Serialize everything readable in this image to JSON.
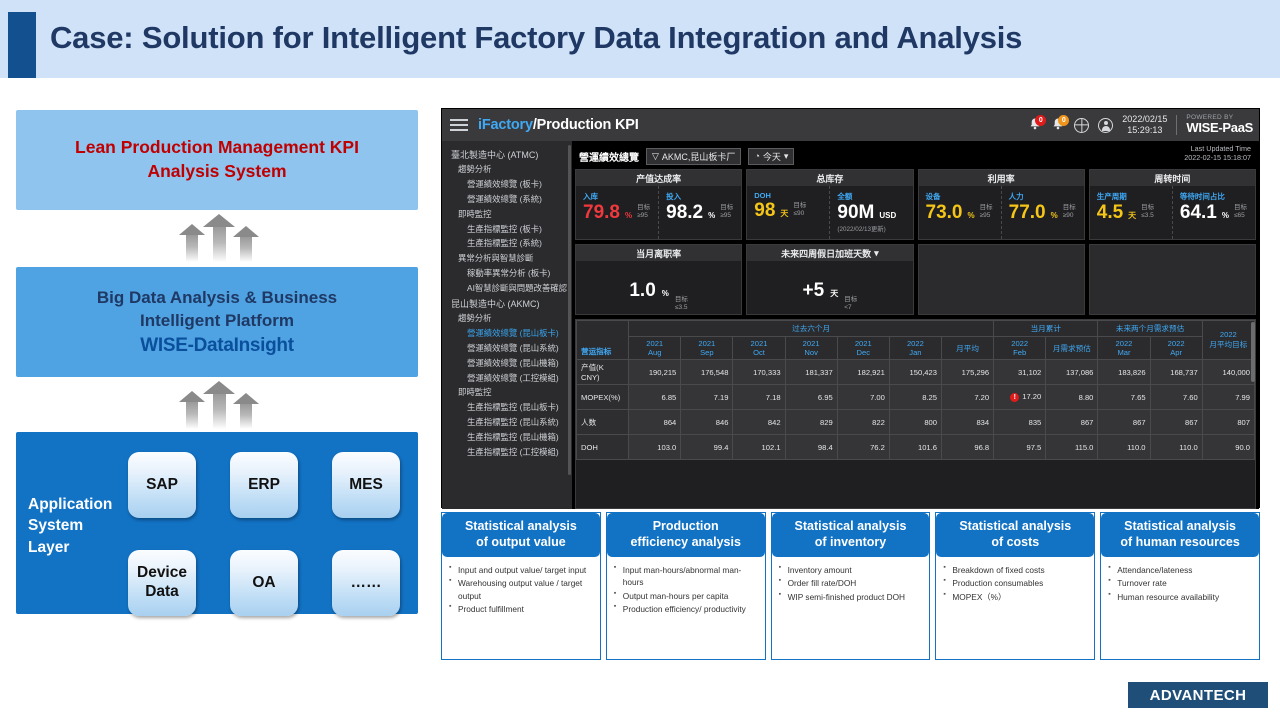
{
  "title": "Case: Solution for Intelligent Factory Data Integration and Analysis",
  "left_stack": {
    "layer1": "Lean Production Management KPI\nAnalysis System",
    "layer1_line1": "Lean Production Management KPI",
    "layer1_line2": "Analysis System",
    "layer2_line1": "Big Data Analysis & Business",
    "layer2_line2": "Intelligent  Platform",
    "layer2_product": "WISE-DataInsight",
    "app_layer_label": "Application\nSystem\nLayer",
    "app_tiles": [
      "SAP",
      "ERP",
      "MES",
      "Device\nData",
      "OA",
      "……"
    ]
  },
  "dashboard": {
    "brand_prefix": "iFactory",
    "brand_suffix": "/Production KPI",
    "notifications": [
      {
        "icon": "bell-icon",
        "count": "0",
        "color": "#e01b1b"
      },
      {
        "icon": "bell-alert-icon",
        "count": "0",
        "color": "#f0951b"
      }
    ],
    "date": "2022/02/15",
    "time": "15:29:13",
    "powered_by_small": "POWERED BY",
    "powered_by_brand": "WISE-PaaS",
    "sidebar": [
      {
        "label": "臺北製造中心 (ATMC)",
        "level": 0,
        "active": false
      },
      {
        "label": "趨勢分析",
        "level": 1,
        "active": false
      },
      {
        "label": "營運績效總覽 (板卡)",
        "level": 2,
        "active": false
      },
      {
        "label": "營運績效總覽 (系統)",
        "level": 2,
        "active": false
      },
      {
        "label": "即時監控",
        "level": 1,
        "active": false
      },
      {
        "label": "生產指標監控 (板卡)",
        "level": 2,
        "active": false
      },
      {
        "label": "生產指標監控 (系統)",
        "level": 2,
        "active": false
      },
      {
        "label": "異常分析與智慧診斷",
        "level": 1,
        "active": false
      },
      {
        "label": "稼動率異常分析 (板卡)",
        "level": 2,
        "active": false
      },
      {
        "label": "AI智慧診斷與問題改善確認",
        "level": 2,
        "active": false
      },
      {
        "label": "昆山製造中心 (AKMC)",
        "level": 0,
        "active": false
      },
      {
        "label": "趨勢分析",
        "level": 1,
        "active": false
      },
      {
        "label": "營運績效總覽 (昆山板卡)",
        "level": 2,
        "active": true
      },
      {
        "label": "營運績效總覽 (昆山系統)",
        "level": 2,
        "active": false
      },
      {
        "label": "營運績效總覽 (昆山機箱)",
        "level": 2,
        "active": false
      },
      {
        "label": "營運績效總覽 (工控模組)",
        "level": 2,
        "active": false
      },
      {
        "label": "即時監控",
        "level": 1,
        "active": false
      },
      {
        "label": "生產指標監控 (昆山板卡)",
        "level": 2,
        "active": false
      },
      {
        "label": "生產指標監控 (昆山系統)",
        "level": 2,
        "active": false
      },
      {
        "label": "生產指標監控 (昆山機箱)",
        "level": 2,
        "active": false
      },
      {
        "label": "生產指標監控 (工控模組)",
        "level": 2,
        "active": false
      }
    ],
    "page_title": "營運績效總覽",
    "filter_chip": "AKMC,昆山板卡厂",
    "time_chip": "今天",
    "last_updated_label": "Last Updated Time",
    "last_updated_value": "2022-02-15 15:18:07",
    "kpi_cards": [
      {
        "title": "产值达成率",
        "metrics": [
          {
            "label": "入库",
            "label_color": "#3fa9f5",
            "value": "79.8",
            "unit": "%",
            "value_color": "#f0383d",
            "target_label": "目标",
            "target_value": "≥95"
          },
          {
            "label": "投入",
            "label_color": "#3fa9f5",
            "value": "98.2",
            "unit": "%",
            "value_color": "#ffffff",
            "target_label": "目标",
            "target_value": "≥95"
          }
        ]
      },
      {
        "title": "总库存",
        "metrics": [
          {
            "label": "DOH",
            "label_color": "#3fa9f5",
            "value": "98",
            "unit": "天",
            "value_color": "#f5c518",
            "target_label": "目标",
            "target_value": "≤90"
          },
          {
            "label": "全额",
            "label_color": "#3fa9f5",
            "value": "90M",
            "unit": "USD",
            "value_color": "#ffffff",
            "note": "(2022/02/13更新)"
          }
        ]
      },
      {
        "title": "利用率",
        "metrics": [
          {
            "label": "设备",
            "label_color": "#3fa9f5",
            "value": "73.0",
            "unit": "%",
            "value_color": "#f5c518",
            "target_label": "目标",
            "target_value": "≥95"
          },
          {
            "label": "人力",
            "label_color": "#3fa9f5",
            "value": "77.0",
            "unit": "%",
            "value_color": "#f5c518",
            "target_label": "目标",
            "target_value": "≥90"
          }
        ]
      },
      {
        "title": "周转时间",
        "metrics": [
          {
            "label": "生产周期",
            "label_color": "#3fa9f5",
            "value": "4.5",
            "unit": "天",
            "value_color": "#f5c518",
            "target_label": "目标",
            "target_value": "≤3.5"
          },
          {
            "label": "等待时间占比",
            "label_color": "#3fa9f5",
            "value": "64.1",
            "unit": "%",
            "value_color": "#ffffff",
            "target_label": "目标",
            "target_value": "≤65"
          }
        ]
      }
    ],
    "kpi_cards_row2": [
      {
        "title": "当月离职率",
        "value": "1.0",
        "unit": "%",
        "target_label": "目标",
        "target_value": "≤3.5"
      },
      {
        "title": "未来四周假日加班天数",
        "value": "+5",
        "unit": "天",
        "target_label": "目标",
        "target_value": "<7",
        "has_caret": true
      }
    ],
    "table": {
      "group_headers": [
        {
          "label": "过去六个月",
          "span": 7
        },
        {
          "label": "当月累计",
          "span": 2
        },
        {
          "label": "未来两个月需求预估",
          "span": 2
        }
      ],
      "metric_col_header": "营运指标",
      "columns": [
        {
          "l1": "2021",
          "l2": "Aug"
        },
        {
          "l1": "2021",
          "l2": "Sep"
        },
        {
          "l1": "2021",
          "l2": "Oct"
        },
        {
          "l1": "2021",
          "l2": "Nov"
        },
        {
          "l1": "2021",
          "l2": "Dec"
        },
        {
          "l1": "2022",
          "l2": "Jan"
        },
        {
          "l1": "",
          "l2": "月平均"
        },
        {
          "l1": "2022",
          "l2": "Feb"
        },
        {
          "l1": "",
          "l2": "月需求预估"
        },
        {
          "l1": "2022",
          "l2": "Mar"
        },
        {
          "l1": "2022",
          "l2": "Apr"
        }
      ],
      "last_col": {
        "l1": "2022",
        "l2": "月平均目标"
      },
      "rows": [
        {
          "name": "产值(K CNY)",
          "values": [
            "190,215",
            "176,548",
            "170,333",
            "181,337",
            "182,921",
            "150,423",
            "175,296",
            "31,102",
            "137,086",
            "183,826",
            "168,737"
          ],
          "target": "140,000"
        },
        {
          "name": "MOPEX(%)",
          "values": [
            "6.85",
            "7.19",
            "7.18",
            "6.95",
            "7.00",
            "8.25",
            "7.20",
            "17.20",
            "8.80",
            "7.65",
            "7.60"
          ],
          "target": "7.99",
          "warn_index": 7
        },
        {
          "name": "人数",
          "values": [
            "864",
            "846",
            "842",
            "829",
            "822",
            "800",
            "834",
            "835",
            "867",
            "867",
            "867"
          ],
          "target": "807"
        },
        {
          "name": "DOH",
          "values": [
            "103.0",
            "99.4",
            "102.1",
            "98.4",
            "76.2",
            "101.6",
            "96.8",
            "97.5",
            "115.0",
            "110.0",
            "110.0"
          ],
          "target": "90.0"
        }
      ]
    }
  },
  "analysis_cards": [
    {
      "title": "Statistical analysis\nof output value",
      "title_line1": "Statistical analysis",
      "title_line2": "of output  value",
      "items": [
        "Input and  output value/ target input",
        "Warehousing output value / target output",
        "Product fulfillment"
      ]
    },
    {
      "title_line1": "Production",
      "title_line2": "efficiency analysis",
      "items": [
        "Input man-hours/abnormal man-hours",
        "Output man-hours per capita",
        "Production efficiency/ productivity"
      ]
    },
    {
      "title_line1": "Statistical analysis",
      "title_line2": "of inventory",
      "items": [
        "Inventory amount",
        "Order  fill rate/DOH",
        "WIP semi-finished product DOH"
      ]
    },
    {
      "title_line1": "Statistical analysis",
      "title_line2": "of costs",
      "items": [
        "Breakdown  of fixed costs",
        "Production consumables",
        "MOPEX（%）"
      ]
    },
    {
      "title_line1": "Statistical analysis",
      "title_line2": "of human resources",
      "items": [
        "Attendance/lateness",
        "Turnover rate",
        "Human resource availability"
      ]
    }
  ],
  "footer_logo": "ADVANTECH",
  "colors": {
    "title_blue": "#1f3864",
    "accent_bar": "#12508f",
    "header_bg": "#cfe2f7",
    "layer1_bg": "#8fc4ef",
    "layer2_bg": "#4fa3e3",
    "app_layer_bg": "#1272c4",
    "red_text": "#c00000",
    "dashboard_accent": "#3fa9f5",
    "warn_red": "#e01b1b"
  }
}
